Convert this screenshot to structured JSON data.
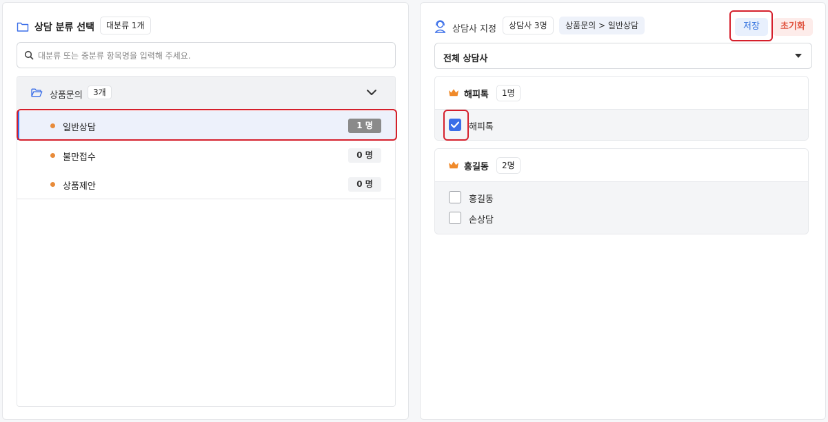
{
  "left": {
    "title": "상담 분류 선택",
    "badge": "대분류 1개",
    "search_placeholder": "대분류 또는 중분류 항목명을 입력해 주세요.",
    "group": {
      "label": "상품문의",
      "count": "3개",
      "items": [
        {
          "label": "일반상담",
          "count": "1 명",
          "active": true
        },
        {
          "label": "불만접수",
          "count": "0 명",
          "active": false
        },
        {
          "label": "상품제안",
          "count": "0 명",
          "active": false
        }
      ]
    }
  },
  "right": {
    "title": "상담사 지정",
    "count_badge": "상담사 3명",
    "path_badge": "상품문의 > 일반상담",
    "save_label": "저장",
    "reset_label": "초기화",
    "select_value": "전체 상담사",
    "groups": [
      {
        "name": "해피톡",
        "count": "1명",
        "members": [
          {
            "label": "해피톡",
            "checked": true
          }
        ]
      },
      {
        "name": "홍길동",
        "count": "2명",
        "members": [
          {
            "label": "홍길동",
            "checked": false
          },
          {
            "label": "손상담",
            "checked": false
          }
        ]
      }
    ]
  },
  "colors": {
    "accent": "#3a6ee8",
    "dot": "#e88b3a",
    "crown": "#f08a2a",
    "highlight": "#d51f2b"
  }
}
